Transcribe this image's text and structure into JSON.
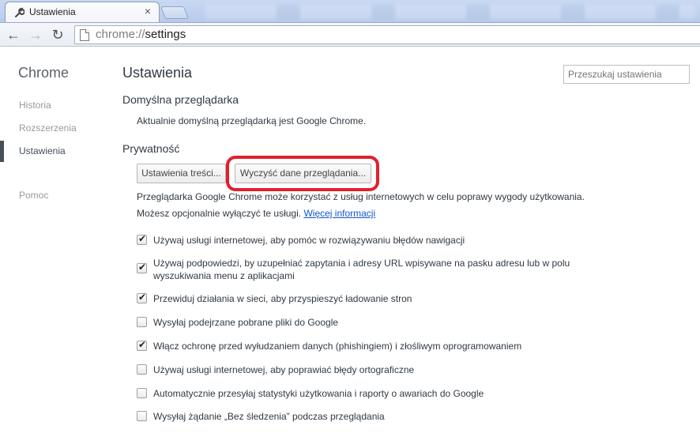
{
  "browser": {
    "tab_title": "Ustawienia",
    "url_scheme": "chrome://",
    "url_host": "settings"
  },
  "sidebar": {
    "title": "Chrome",
    "items": [
      {
        "label": "Historia"
      },
      {
        "label": "Rozszerzenia"
      },
      {
        "label": "Ustawienia",
        "active": true
      },
      {
        "label": "Pomoc"
      }
    ]
  },
  "main": {
    "title": "Ustawienia",
    "search_placeholder": "Przeszukaj ustawienia",
    "default_browser": {
      "title": "Domyślna przeglądarka",
      "text": "Aktualnie domyślną przeglądarką jest Google Chrome."
    },
    "privacy": {
      "title": "Prywatność",
      "content_settings_button": "Ustawienia treści...",
      "clear_data_button": "Wyczyść dane przeglądania...",
      "info_line1": "Przeglądarka Google Chrome może korzystać z usług internetowych w celu poprawy wygody użytkowania.",
      "info_line2": "Możesz opcjonalnie wyłączyć te usługi.",
      "learn_more": "Więcej informacji",
      "options": [
        {
          "label": "Używaj usługi internetowej, aby pomóc w rozwiązywaniu błędów nawigacji",
          "checked": true
        },
        {
          "label": "Używaj podpowiedzi, by uzupełniać zapytania i adresy URL wpisywane na pasku adresu lub w polu wyszukiwania menu z aplikacjami",
          "checked": true
        },
        {
          "label": "Przewiduj działania w sieci, aby przyspieszyć ładowanie stron",
          "checked": true
        },
        {
          "label": "Wysyłaj podejrzane pobrane pliki do Google",
          "checked": false
        },
        {
          "label": "Włącz ochronę przed wyłudzaniem danych (phishingiem) i złośliwym oprogramowaniem",
          "checked": true
        },
        {
          "label": "Używaj usługi internetowej, aby poprawiać błędy ortograficzne",
          "checked": false
        },
        {
          "label": "Automatycznie przesyłaj statystyki użytkowania i raporty o awariach do Google",
          "checked": false
        },
        {
          "label": "Wysyłaj żądanie „Bez śledzenia” podczas przeglądania",
          "checked": false
        }
      ]
    }
  },
  "colors": {
    "highlight": "#e0202e",
    "link": "#1155cc"
  }
}
